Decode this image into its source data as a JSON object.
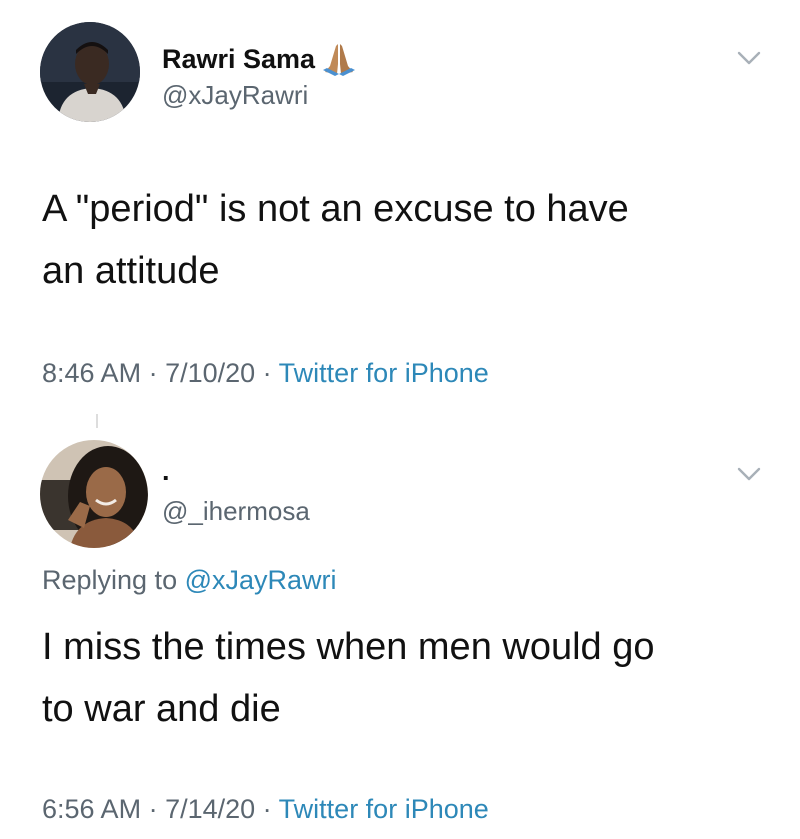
{
  "tweets": [
    {
      "display_name": "Rawri Sama",
      "emoji_icon": "folded-hands-icon",
      "handle": "@xJayRawri",
      "text_lines": [
        "A \"period\" is not an excuse to have",
        "an attitude"
      ],
      "time": "8:46 AM",
      "date": "7/10/20",
      "source": "Twitter for iPhone"
    },
    {
      "display_name": ".",
      "handle": "@_ihermosa",
      "replying_prefix": "Replying to",
      "replying_to": "@xJayRawri",
      "text_lines": [
        "I miss the times when men would go",
        "to war and die"
      ],
      "time": "6:56 AM",
      "date": "7/14/20",
      "source": "Twitter for iPhone"
    }
  ],
  "separator": " · ",
  "colors": {
    "text": "#111111",
    "secondary": "#5b6670",
    "link": "#2d88b8",
    "chevron": "#a8b0b8"
  }
}
